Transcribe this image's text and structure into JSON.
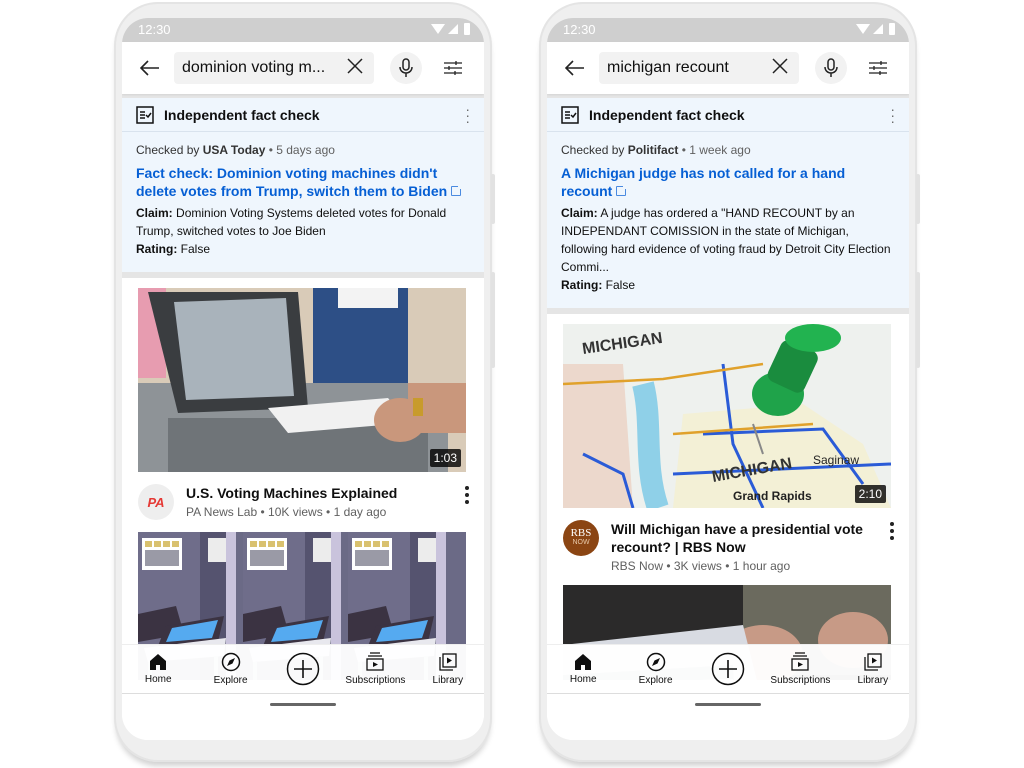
{
  "phones": [
    {
      "status_time": "12:30",
      "search": {
        "query": "dominion voting m...",
        "back_label": "back",
        "clear_label": "clear"
      },
      "fact_check": {
        "header": "Independent fact check",
        "checked_by_prefix": "Checked by ",
        "publisher": "USA Today",
        "age": " • 5 days ago",
        "headline": "Fact check: Dominion voting machines didn't delete votes from Trump, switch them to Biden",
        "claim_label": "Claim:",
        "claim": " Dominion Voting Systems deleted votes for Donald Trump, switched votes to Joe Biden",
        "rating_label": "Rating:",
        "rating": " False"
      },
      "videos": [
        {
          "title": "U.S. Voting Machines Explained",
          "channel_line": "PA News Lab • 10K views • 1 day ago",
          "duration": "1:03",
          "avatar_text": "PA",
          "avatar_sub": "",
          "thumb": "voting-machine-photo"
        },
        {
          "title": "",
          "channel_line": "",
          "duration": "",
          "thumb": "voting-booth-illustration"
        }
      ]
    },
    {
      "status_time": "12:30",
      "search": {
        "query": "michigan recount",
        "back_label": "back",
        "clear_label": "clear"
      },
      "fact_check": {
        "header": "Independent fact check",
        "checked_by_prefix": "Checked by ",
        "publisher": "Politifact",
        "age": " • 1 week ago",
        "headline": "A Michigan judge has not called for a hand recount",
        "claim_label": "Claim:",
        "claim": " A judge has ordered a \"HAND RECOUNT by an INDEPENDANT COMISSION in the state of Michigan, following hard evidence of voting fraud by Detroit City Election Commi...",
        "rating_label": "Rating:",
        "rating": " False"
      },
      "videos": [
        {
          "title": "Will Michigan have a presidential vote recount? | RBS Now",
          "channel_line": "RBS Now • 3K views • 1 hour ago",
          "duration": "2:10",
          "avatar_text": "RBS",
          "avatar_sub": "NOW",
          "thumb": "michigan-map-pin-photo"
        },
        {
          "title": "",
          "channel_line": "",
          "duration": "",
          "thumb": "ballot-stacks-photo"
        }
      ]
    }
  ],
  "nav": {
    "items": [
      {
        "label": "Home",
        "icon": "home-icon"
      },
      {
        "label": "Explore",
        "icon": "compass-icon"
      },
      {
        "label": "",
        "icon": "create-plus-icon"
      },
      {
        "label": "Subscriptions",
        "icon": "subscriptions-icon"
      },
      {
        "label": "Library",
        "icon": "library-icon"
      }
    ]
  },
  "colors": {
    "link": "#065fd4",
    "fact_check_bg": "#eff6fd",
    "pa_red": "#e53935",
    "rbs_brown": "#8b4513"
  }
}
